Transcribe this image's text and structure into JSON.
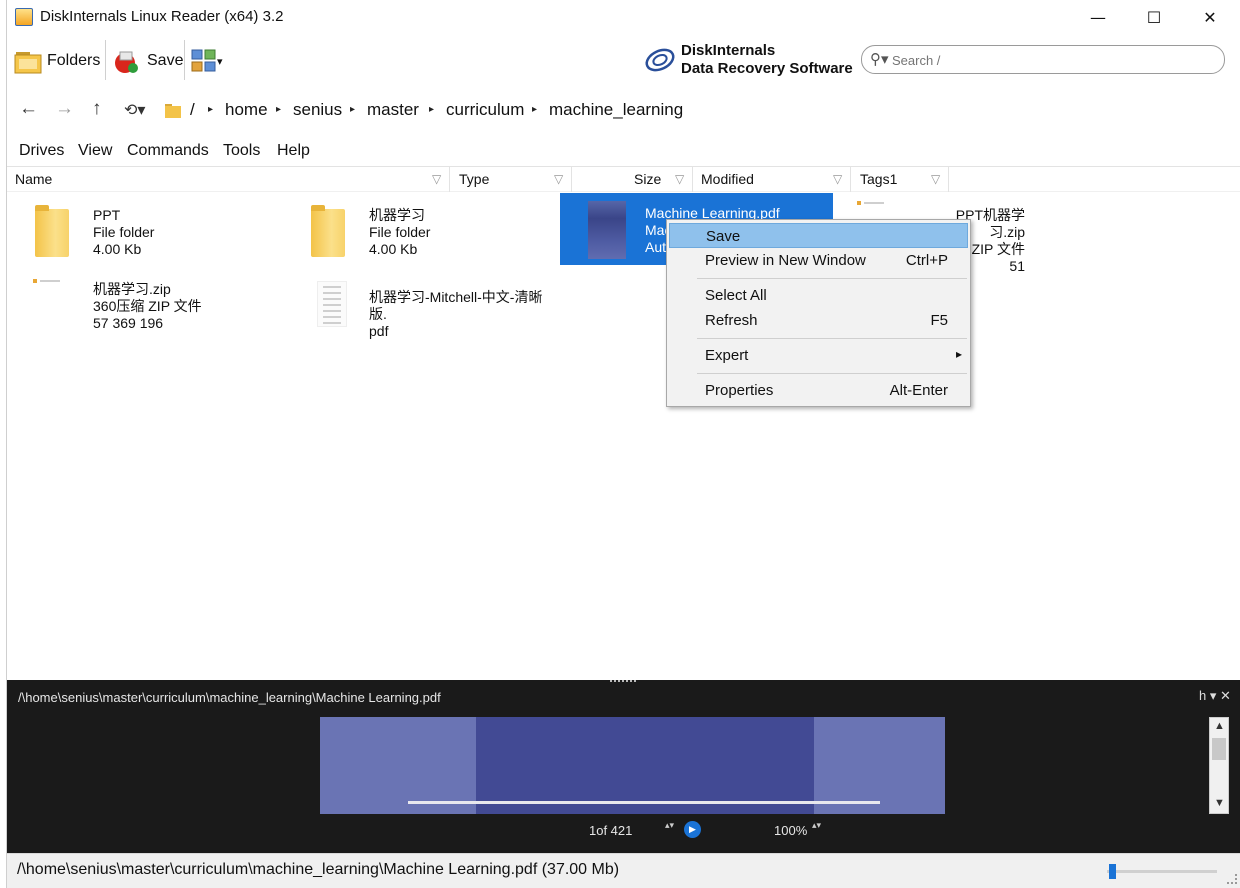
{
  "window": {
    "title": "DiskInternals Linux Reader (x64) 3.2",
    "minimize_glyph": "—",
    "maximize_glyph": "☐",
    "close_glyph": "✕"
  },
  "toolbar": {
    "folders_label": "Folders",
    "save_label": "Save",
    "view_dropdown_glyph": "▾",
    "brand_line1": "DiskInternals",
    "brand_line2": "Data Recovery Software",
    "search_placeholder": "Search /"
  },
  "address": {
    "back": "←",
    "forward": "→",
    "up": "↑",
    "history": "⟲▾",
    "root": "/",
    "separator": "▸",
    "crumbs": [
      "home",
      "senius",
      "master",
      "curriculum",
      "machine_learning"
    ]
  },
  "menu": [
    "Drives",
    "View",
    "Commands",
    "Tools",
    "Help"
  ],
  "columns": [
    "Name",
    "Type",
    "Size",
    "Modified",
    "Tags1"
  ],
  "files": [
    {
      "name": "PPT",
      "line2": "File folder",
      "line3": "4.00 Kb",
      "kind": "folder"
    },
    {
      "name": "机器学习",
      "line2": "File folder",
      "line3": "4.00 Kb",
      "kind": "folder"
    },
    {
      "name": "Machine Learning.pdf",
      "line2": "Mac",
      "line3": "Aut",
      "kind": "pdf",
      "selected": true
    },
    {
      "name": "PPT机器学习.zip",
      "line2": "ZIP 文件",
      "line3": "51",
      "kind": "zip"
    },
    {
      "name": "机器学习.zip",
      "line2": "360压缩 ZIP 文件",
      "line3": "57 369 196",
      "kind": "zip"
    },
    {
      "name": "机器学习-Mitchell-中文-清晰版.",
      "line2": "pdf",
      "line3": "",
      "kind": "pdf"
    }
  ],
  "context_menu": {
    "save": "Save",
    "preview": "Preview in New Window",
    "preview_shortcut": "Ctrl+P",
    "select_all": "Select All",
    "refresh": "Refresh",
    "refresh_shortcut": "F5",
    "expert": "Expert",
    "expert_arrow": "▸",
    "properties": "Properties",
    "properties_shortcut": "Alt-Enter"
  },
  "preview": {
    "path": "/\\home\\senius\\master\\curriculum\\machine_learning\\Machine Learning.pdf",
    "controls": "h ▾ ✕",
    "page": "1of 421",
    "zoom": "100%",
    "spin": "▴▾",
    "play": "▶"
  },
  "status": {
    "text": "/\\home\\senius\\master\\curriculum\\machine_learning\\Machine Learning.pdf (37.00 Mb)",
    "slider_fraction": 0.02
  },
  "colors": {
    "selection": "#1a73d6",
    "menu_highlight": "#8fc1ec",
    "preview_bg": "#1a1a1a"
  }
}
